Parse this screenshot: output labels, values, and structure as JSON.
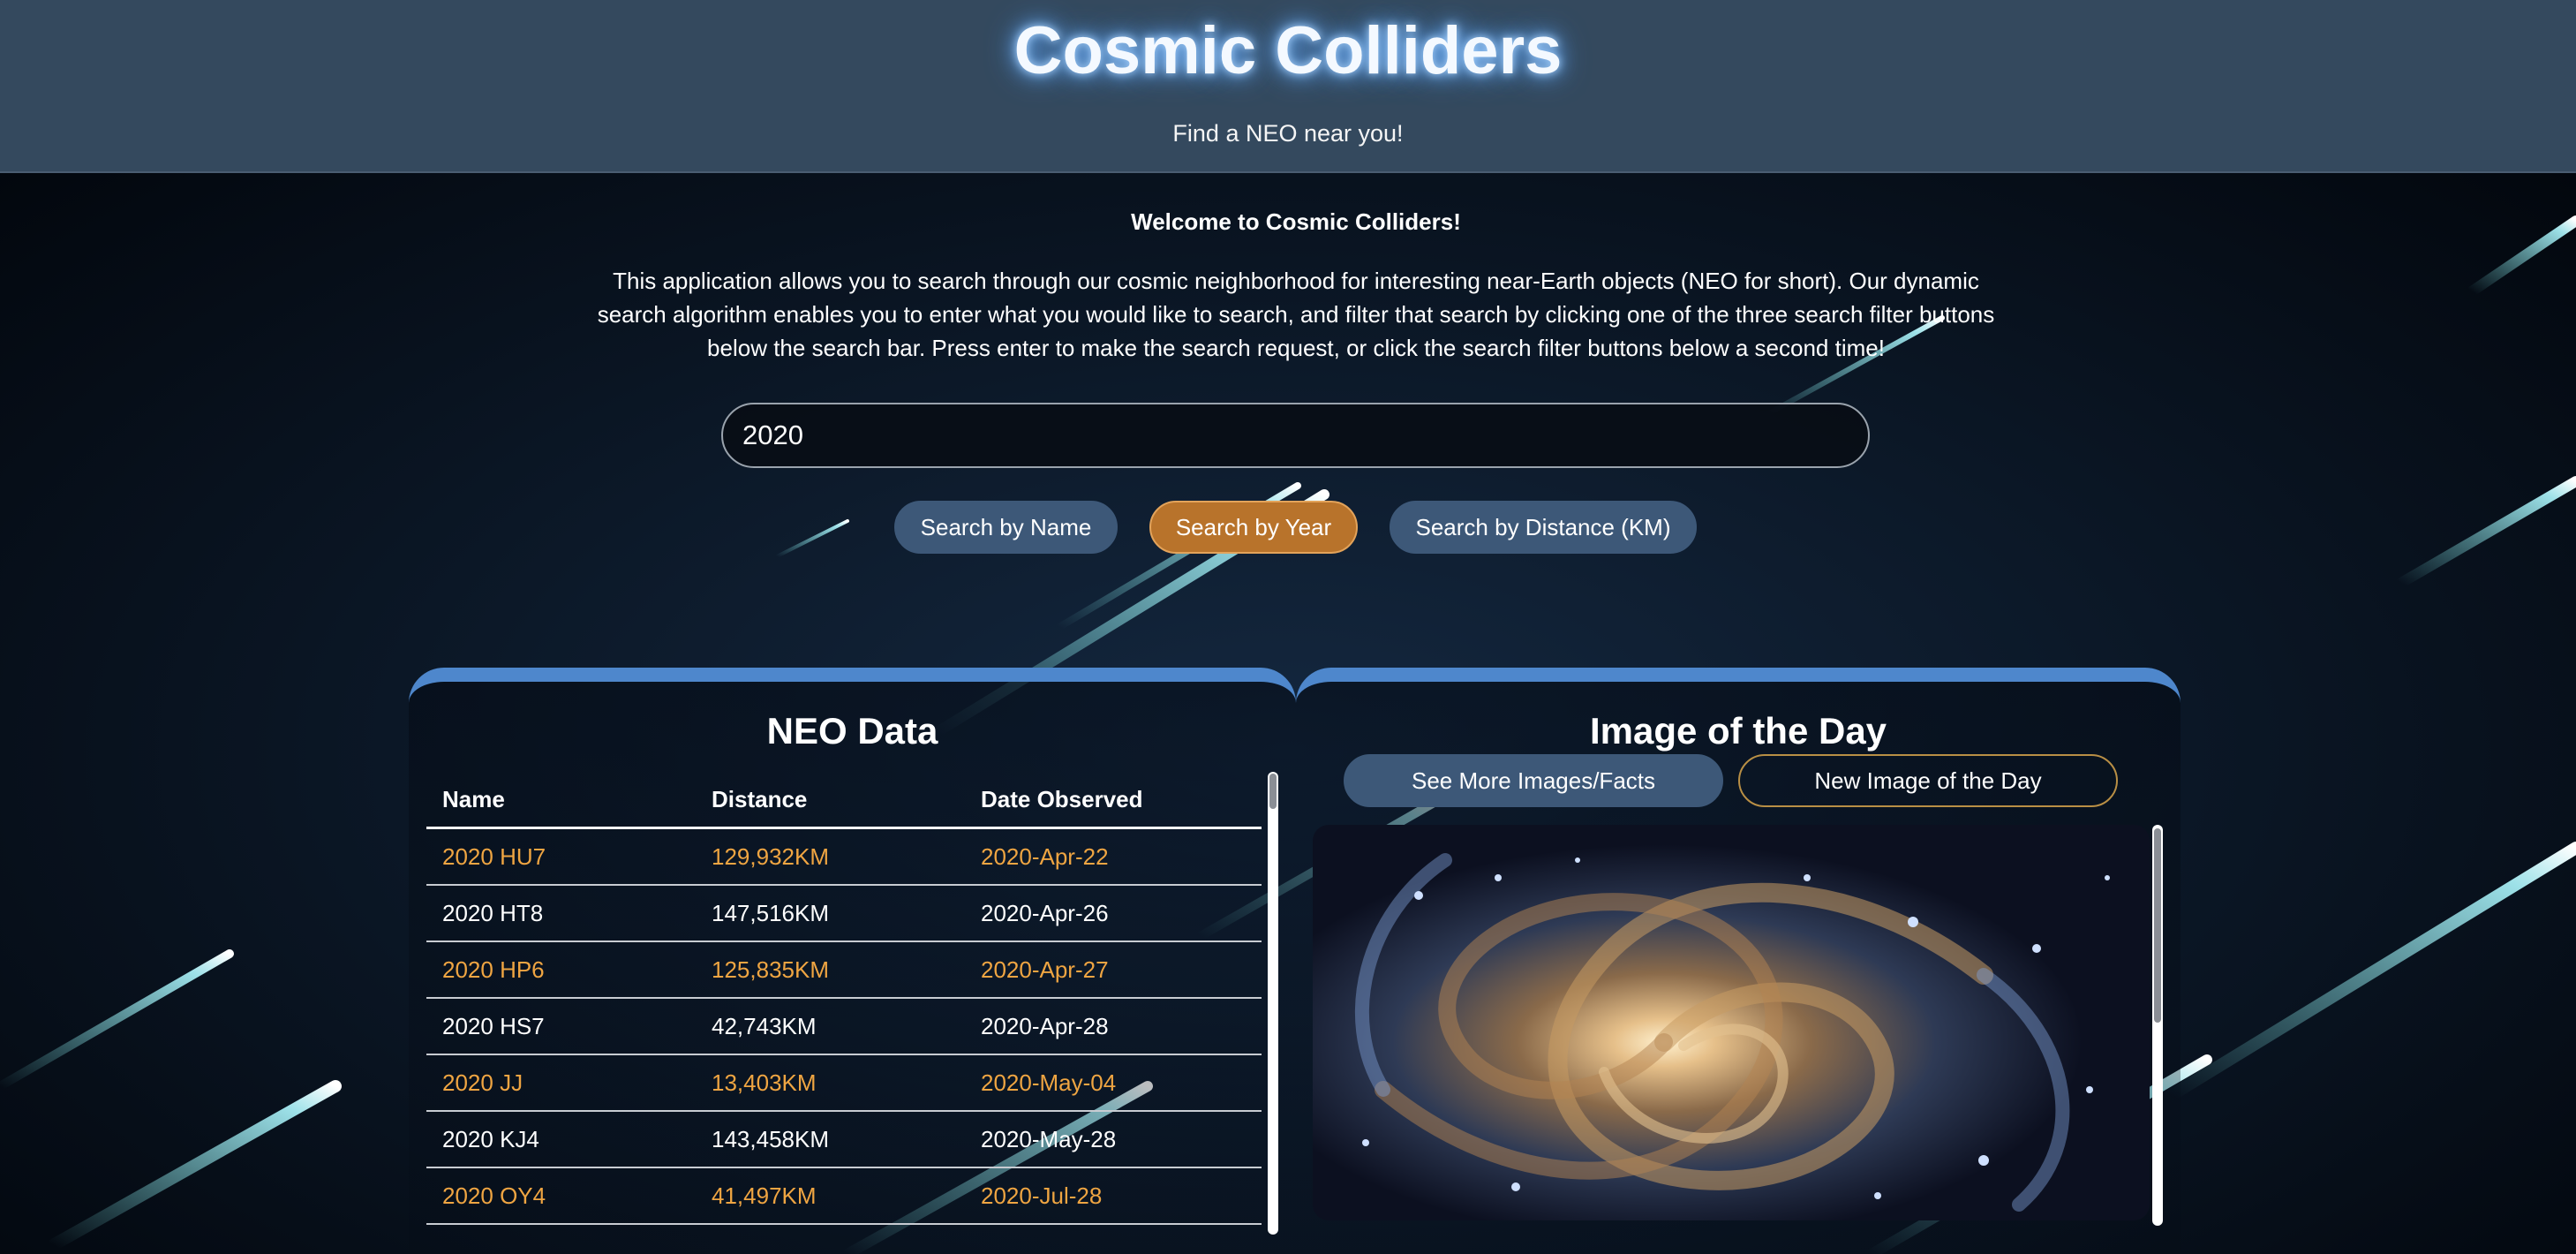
{
  "header": {
    "title": "Cosmic Colliders",
    "subtitle": "Find a NEO near you!"
  },
  "intro": {
    "welcome": "Welcome to Cosmic Colliders!",
    "description": "This application allows you to search through our cosmic neighborhood for interesting near-Earth objects (NEO for short). Our dynamic search algorithm enables you to enter what you would like to search, and filter that search by clicking one of the three search filter buttons below the search bar. Press enter to make the search request, or click the search filter buttons below a second time!"
  },
  "search": {
    "value": "2020"
  },
  "filters": {
    "by_name": "Search by Name",
    "by_year": "Search by Year",
    "by_distance": "Search by Distance (KM)",
    "active": "by_year"
  },
  "neo_panel": {
    "title": "NEO Data",
    "columns": [
      "Name",
      "Distance",
      "Date Observed"
    ],
    "rows": [
      {
        "name": "2020 HU7",
        "distance": "129,932KM",
        "date": "2020-Apr-22"
      },
      {
        "name": "2020 HT8",
        "distance": "147,516KM",
        "date": "2020-Apr-26"
      },
      {
        "name": "2020 HP6",
        "distance": "125,835KM",
        "date": "2020-Apr-27"
      },
      {
        "name": "2020 HS7",
        "distance": "42,743KM",
        "date": "2020-Apr-28"
      },
      {
        "name": "2020 JJ",
        "distance": "13,403KM",
        "date": "2020-May-04"
      },
      {
        "name": "2020 KJ4",
        "distance": "143,458KM",
        "date": "2020-May-28"
      },
      {
        "name": "2020 OY4",
        "distance": "41,497KM",
        "date": "2020-Jul-28"
      }
    ]
  },
  "iotd_panel": {
    "title": "Image of the Day",
    "see_more_label": "See More Images/Facts",
    "new_image_label": "New Image of the Day"
  },
  "colors": {
    "header_bg": "#34495e",
    "panel_accent": "#4e87cc",
    "active_filter": "#b8732b",
    "button_blue": "#3d5878",
    "highlight_text": "#efa542"
  }
}
